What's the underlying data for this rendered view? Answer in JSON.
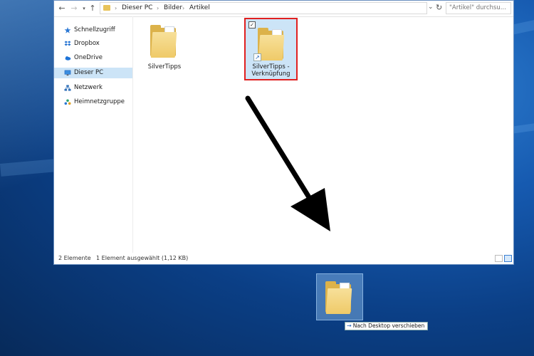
{
  "window": {
    "address": {
      "back_icon": "back-arrow-icon",
      "forward_icon": "forward-arrow-icon",
      "recent_icon": "chevron-down-icon",
      "up_icon": "up-arrow-icon",
      "breadcrumbs": [
        "Dieser PC",
        "Bilder",
        "Artikel"
      ],
      "separator": "›",
      "refresh_icon": "refresh-icon",
      "search_placeholder": "\"Artikel\" durchsu..."
    },
    "sidebar": {
      "items": [
        {
          "label": "Schnellzugriff",
          "icon": "star-icon",
          "color": "#2b78d4"
        },
        {
          "label": "Dropbox",
          "icon": "dropbox-icon",
          "color": "#1f6fd1"
        },
        {
          "label": "OneDrive",
          "icon": "cloud-icon",
          "color": "#1e74d8"
        },
        {
          "label": "Dieser PC",
          "icon": "computer-icon",
          "color": "#3a8de0",
          "selected": true
        },
        {
          "label": "Netzwerk",
          "icon": "network-icon",
          "color": "#2f6fb8"
        },
        {
          "label": "Heimnetzgruppe",
          "icon": "homegroup-icon",
          "color": "#2aa36f"
        }
      ]
    },
    "files": [
      {
        "name": "SilverTipps",
        "icon": "folder-icon",
        "selected": false
      },
      {
        "name_line1": "SilverTipps -",
        "name_line2": "Verknüpfung",
        "icon": "folder-shortcut-icon",
        "selected": true,
        "checked": "✓"
      }
    ],
    "status": {
      "count": "2 Elemente",
      "selection": "1 Element ausgewählt (1,12 KB)"
    }
  },
  "drag": {
    "tooltip": "Nach Desktop verschieben",
    "tooltip_icon": "→"
  },
  "colors": {
    "selection_highlight": "#cce4f7",
    "annotation_red": "#e02020",
    "folder_yellow": "#efca68"
  }
}
